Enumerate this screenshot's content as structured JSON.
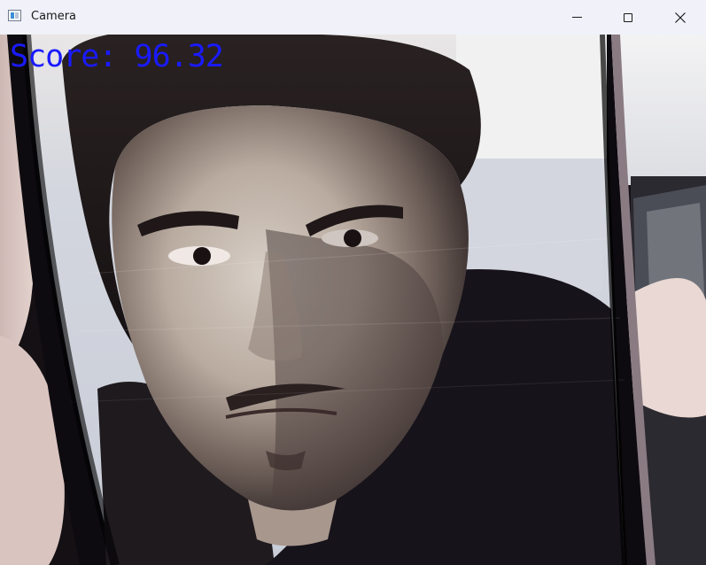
{
  "window": {
    "title": "Camera",
    "icon": "camera-app-icon",
    "controls": [
      "minimize-icon",
      "maximize-icon",
      "close-icon"
    ]
  },
  "overlay": {
    "score_text": "Score: 96.32",
    "score_color": "#1a1aff"
  },
  "feed": {
    "description_icon": "camera-feed-image"
  }
}
